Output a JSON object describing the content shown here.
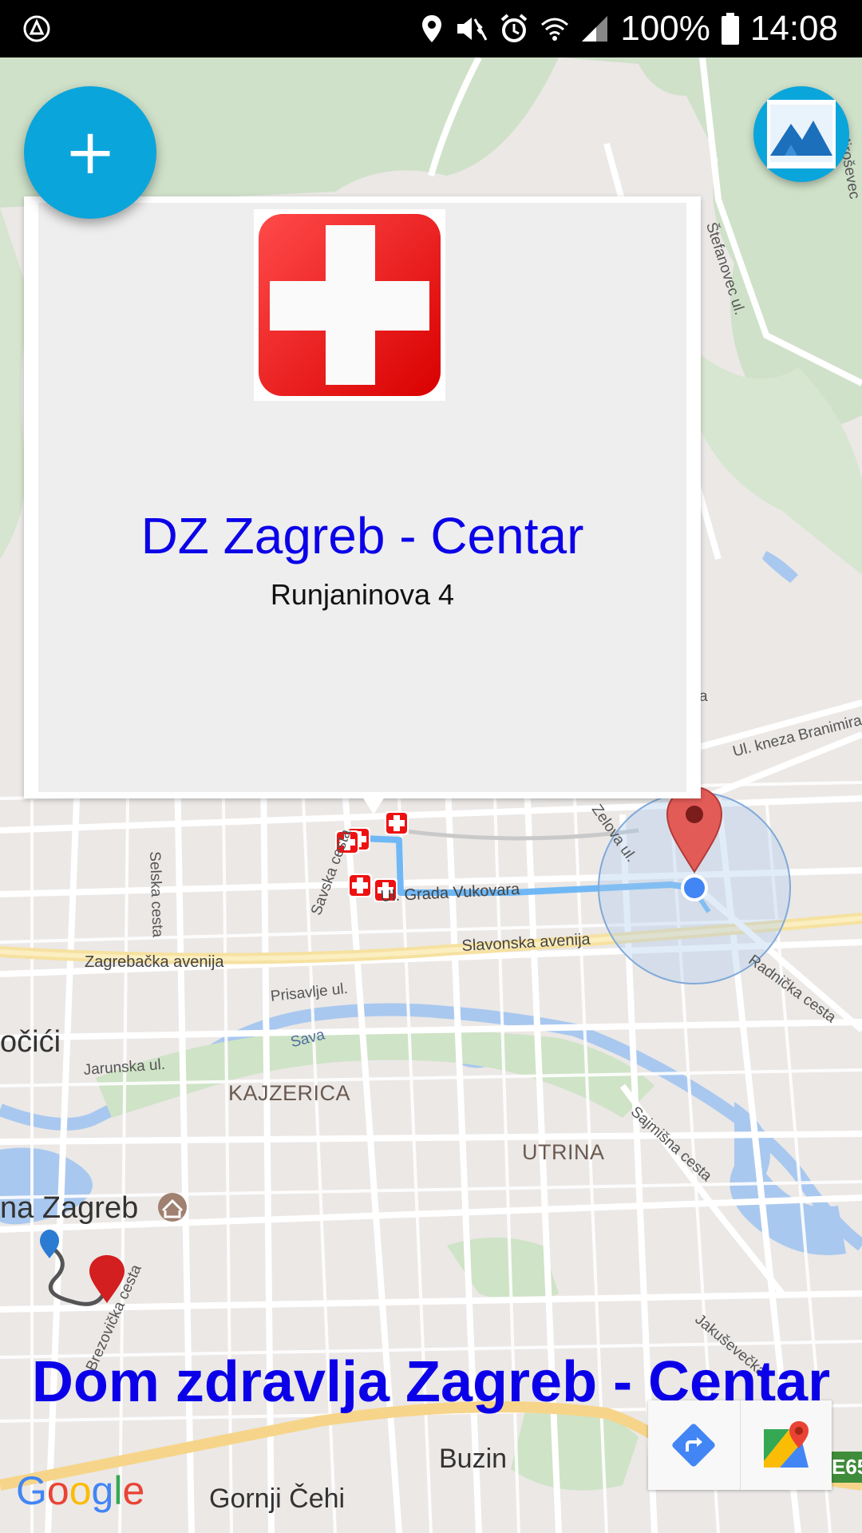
{
  "status_bar": {
    "battery_text": "100%",
    "time": "14:08",
    "icons": [
      "auto-rotate-icon",
      "location-icon",
      "mute-vibrate-icon",
      "alarm-icon",
      "wifi-icon",
      "signal-icon",
      "battery-icon"
    ]
  },
  "fab": {
    "add_icon": "+",
    "terrain_icon": "terrain-layer-icon"
  },
  "info_window": {
    "image_icon": "red-cross-icon",
    "title": "DZ Zagreb - Centar",
    "address": "Runjaninova 4"
  },
  "map": {
    "streets": {
      "stefanovec": "Štefanovec ul.",
      "mirosevec": "Miroševec",
      "kneza_branimira": "Ul. kneza Branimira",
      "zelova": "Zelova ul.",
      "savska": "Savska cesta",
      "selska": "Selska cesta",
      "grada_vukovara": "Ul. Grada Vukovara",
      "zagrebacka": "Zagrebačka avenija",
      "slavonska": "Slavonska avenija",
      "radnicka": "Radnička cesta",
      "prisavlje": "Prisavlje ul.",
      "sava": "Sava",
      "jarunska": "Jarunska ul.",
      "sajmisna": "Sajmišna cesta",
      "brezovicka": "Brezovička cesta",
      "jakusevecka": "Jakuševečka",
      "a_fragment": "a"
    },
    "places": {
      "kajzerica": "KAJZERICA",
      "utrina": "UTRINA",
      "vrbani_fragment": "očići",
      "zagreb_fragment": "na Zagreb",
      "buzin": "Buzin",
      "gornji_cehi": "Gornji Čehi"
    },
    "road_badge": "E65",
    "attribution": "Google",
    "colors": {
      "route": "#6fb8f5",
      "my_location": "#4285f4",
      "marker_red": "#e25b57",
      "accuracy_circle": "#a9c8ee"
    }
  },
  "bottom_title": "Dom zdravlja Zagreb - Centar",
  "toolbar": {
    "directions_icon": "directions-icon",
    "maps_icon": "google-maps-icon"
  }
}
